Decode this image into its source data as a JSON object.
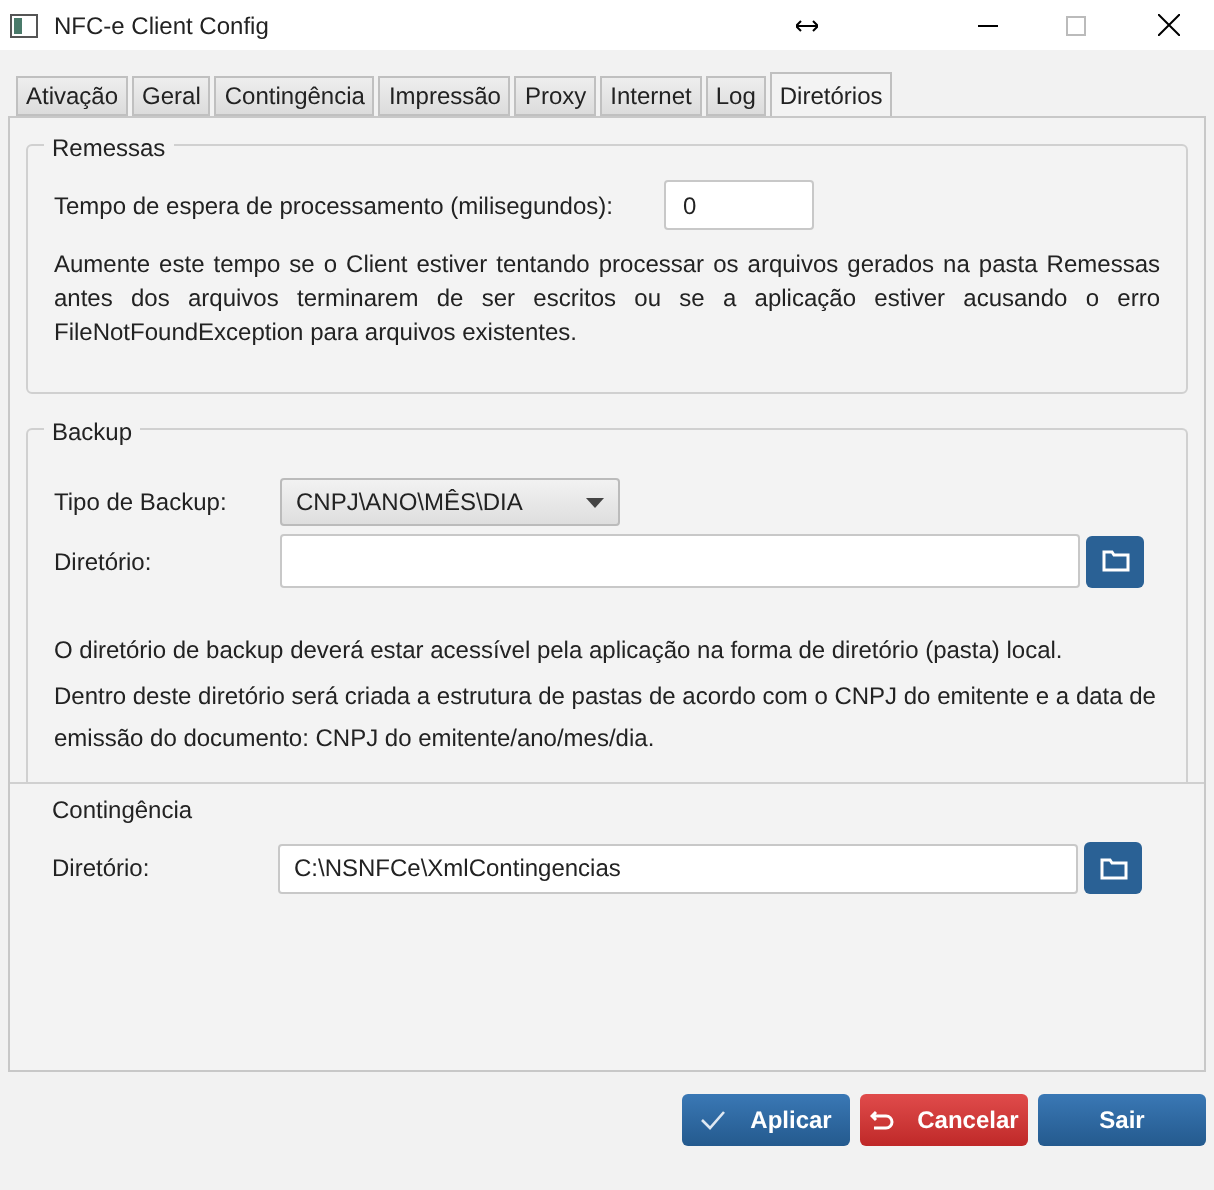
{
  "window": {
    "title": "NFC-e Client Config"
  },
  "tabs": [
    {
      "label": "Ativação",
      "selected": false
    },
    {
      "label": "Geral",
      "selected": false
    },
    {
      "label": "Contingência",
      "selected": false
    },
    {
      "label": "Impressão",
      "selected": false
    },
    {
      "label": "Proxy",
      "selected": false
    },
    {
      "label": "Internet",
      "selected": false
    },
    {
      "label": "Log",
      "selected": false
    },
    {
      "label": "Diretórios",
      "selected": true
    }
  ],
  "remessas": {
    "title": "Remessas",
    "label": "Tempo de espera de processamento (milisegundos):",
    "value": "0",
    "note": "Aumente este tempo se o Client estiver tentando processar os arquivos gerados na pasta Remessas antes dos arquivos terminarem de ser escritos ou se a aplicação estiver acusando o erro FileNotFoundException para arquivos existentes."
  },
  "backup": {
    "title": "Backup",
    "type_label": "Tipo de Backup:",
    "type_value": "CNPJ\\ANO\\MÊS\\DIA",
    "dir_label": "Diretório:",
    "notes": [
      "O diretório de backup deverá estar acessível pela aplicação na forma de diretório (pasta) local.",
      "Dentro deste diretório será criada a estrutura de pastas de acordo com o CNPJ do emitente e a data de emissão do documento: CNPJ do emitente/ano/mes/dia."
    ]
  },
  "contingencia": {
    "title": "Contingência",
    "dir_label": "Diretório:",
    "dir_value": "C:\\NSNFCe\\XmlContingencias"
  },
  "buttons": [
    {
      "label": "Aplicar",
      "kind": "apply"
    },
    {
      "label": "Cancelar",
      "kind": "cancel"
    },
    {
      "label": "Sair",
      "kind": "exit"
    }
  ]
}
